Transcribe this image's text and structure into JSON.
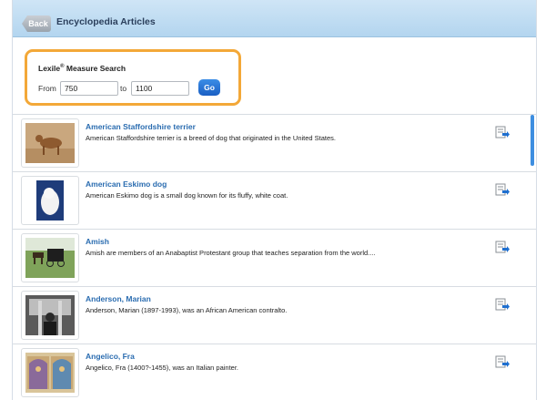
{
  "header": {
    "back_label": "Back",
    "title": "Encyclopedia Articles"
  },
  "lexile": {
    "title": "Lexile",
    "title_reg": "®",
    "title_rest": " Measure Search",
    "from_label": "From",
    "from_value": "750",
    "to_label": "to",
    "to_value": "1100",
    "go_label": "Go"
  },
  "articles": [
    {
      "title": "American Staffordshire terrier",
      "desc": "American Staffordshire terrier is a breed of dog that originated in the United States."
    },
    {
      "title": "American Eskimo dog",
      "desc": "American Eskimo dog is a small dog known for its fluffy, white coat."
    },
    {
      "title": "Amish",
      "desc": "Amish are members of an Anabaptist Protestant group that teaches separation from the world...."
    },
    {
      "title": "Anderson, Marian",
      "desc": "Anderson, Marian (1897-1993), was an African American contralto."
    },
    {
      "title": "Angelico, Fra",
      "desc": "Angelico, Fra (1400?-1455), was an Italian painter."
    }
  ],
  "colors": {
    "accent_orange": "#f3a838",
    "link_blue": "#2a6cb0",
    "go_blue": "#1a5fc4"
  }
}
